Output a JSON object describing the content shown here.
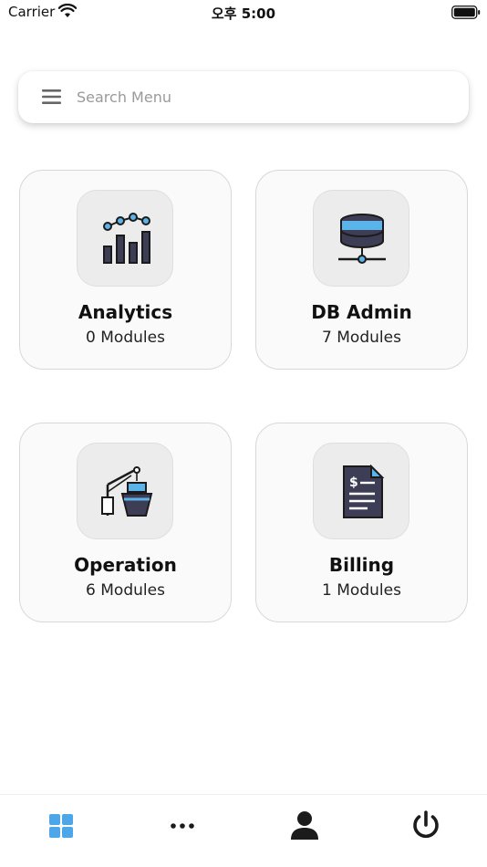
{
  "status_bar": {
    "carrier": "Carrier",
    "time": "오후 5:00"
  },
  "search": {
    "placeholder": "Search Menu",
    "icon": "menu-icon"
  },
  "cards": [
    {
      "title": "Analytics",
      "subtitle": "0 Modules",
      "icon": "analytics-chart-icon"
    },
    {
      "title": "DB Admin",
      "subtitle": "7 Modules",
      "icon": "database-server-icon"
    },
    {
      "title": "Operation",
      "subtitle": "6 Modules",
      "icon": "port-crane-ship-icon"
    },
    {
      "title": "Billing",
      "subtitle": "1 Modules",
      "icon": "invoice-document-icon"
    }
  ],
  "bottom_nav": {
    "items": [
      {
        "icon": "dashboard-grid-icon",
        "active": true
      },
      {
        "icon": "more-dots-icon",
        "active": false
      },
      {
        "icon": "profile-person-icon",
        "active": false
      },
      {
        "icon": "power-icon",
        "active": false
      }
    ]
  },
  "colors": {
    "accent_active": "#4da6e8",
    "icon_dark": "#1b1b1b",
    "card_bg": "#fafafa",
    "illustration_blue": "#5ab4ea",
    "illustration_navy": "#3d3d55"
  }
}
